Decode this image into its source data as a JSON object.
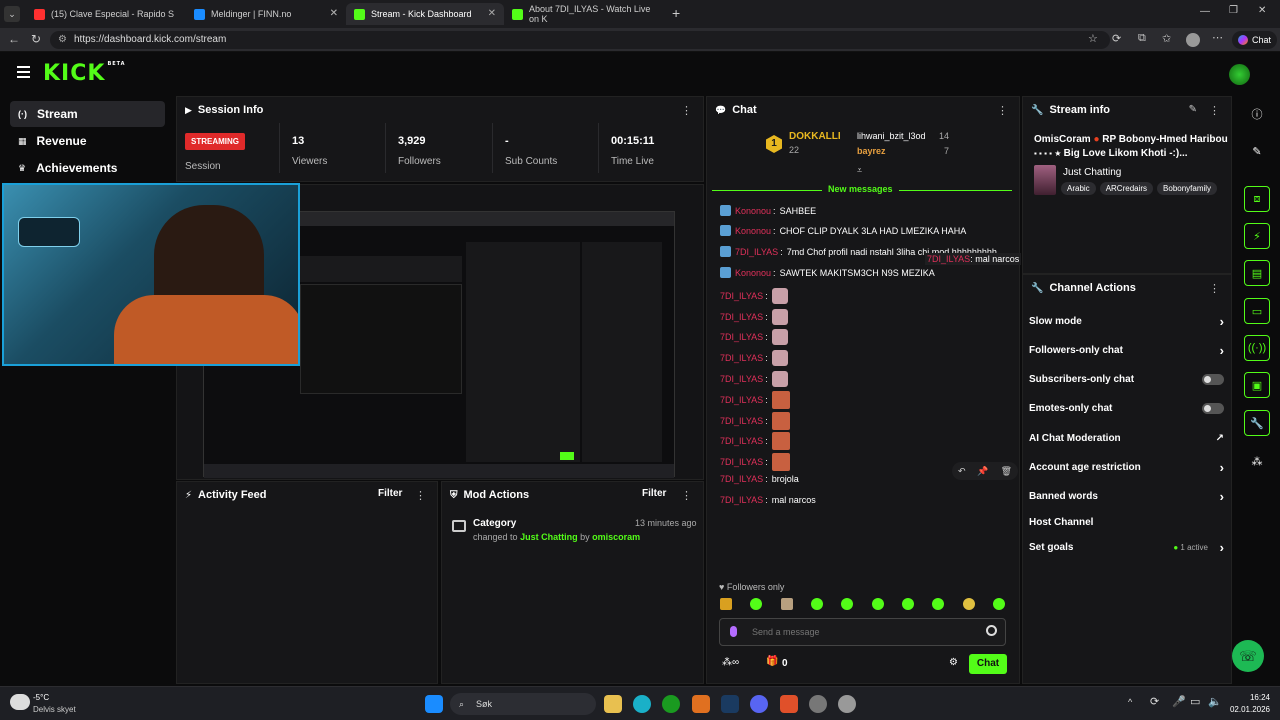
{
  "browser": {
    "tabs": [
      {
        "title": "(15) Clave Especial - Rapido S",
        "color": "#ff3030"
      },
      {
        "title": "Meldinger | FINN.no",
        "color": "#1a8cff"
      },
      {
        "title": "Stream - Kick Dashboard",
        "color": "#53fc18"
      },
      {
        "title": "About 7DI_ILYAS - Watch Live on K",
        "color": "#53fc18"
      }
    ],
    "url": "https://dashboard.kick.com/stream",
    "copilot_label": "Chat"
  },
  "brand": {
    "logo": "KICK",
    "beta": "BETA",
    "accent": "#53fc18"
  },
  "sidebar": {
    "items": [
      {
        "label": "Stream",
        "icon": "broadcast-icon"
      },
      {
        "label": "Revenue",
        "icon": "money-icon"
      },
      {
        "label": "Achievements",
        "icon": "trophy-icon"
      }
    ]
  },
  "session": {
    "title": "Session Info",
    "badge": "STREAMING",
    "badge_label": "Session",
    "stats": [
      {
        "value": "13",
        "label": "Viewers"
      },
      {
        "value": "3,929",
        "label": "Followers"
      },
      {
        "value": "-",
        "label": "Sub Counts"
      },
      {
        "value": "00:15:11",
        "label": "Time Live"
      }
    ]
  },
  "activity": {
    "title": "Activity Feed",
    "filter": "Filter"
  },
  "mod": {
    "title": "Mod Actions",
    "filter": "Filter",
    "entry": {
      "title": "Category",
      "time": "13 minutes ago",
      "pre": "changed to",
      "category": "Just Chatting",
      "by": "by",
      "user": "omiscoram"
    }
  },
  "chat": {
    "title": "Chat",
    "top": {
      "rank1": "1",
      "user1": "DOKKALLI",
      "count1": "22",
      "user2": "lihwani_bzit_l3od",
      "count2": "14",
      "user3": "bayrez",
      "count3": "7"
    },
    "new_messages": "New messages",
    "messages": [
      {
        "user": "Kononou",
        "text": "SAHBEE",
        "icon": true
      },
      {
        "user": "Kononou",
        "text": "CHOF CLIP DYALK 3LA HAD LMEZIKA HAHA",
        "icon": true
      },
      {
        "user": "7DI_ILYAS",
        "text": "7md Chof profil nadi nstahl 3liha chi mod hhhhhhhhh",
        "icon": true
      },
      {
        "user": "Kononou",
        "text": "SAWTEK MAKITSM3CH N9S MEZIKA",
        "icon": true
      },
      {
        "user": "7DI_ILYAS",
        "text": "",
        "emote": 1
      },
      {
        "user": "7DI_ILYAS",
        "text": "",
        "emote": 1
      },
      {
        "user": "7DI_ILYAS",
        "text": "",
        "emote": 1
      },
      {
        "user": "7DI_ILYAS",
        "text": "",
        "emote": 1
      },
      {
        "user": "7DI_ILYAS",
        "text": "",
        "emote": 1
      },
      {
        "user": "7DI_ILYAS",
        "text": "",
        "emote": 2
      },
      {
        "user": "7DI_ILYAS",
        "text": "",
        "emote": 2
      },
      {
        "user": "7DI_ILYAS",
        "text": "",
        "emote": 2
      },
      {
        "user": "7DI_ILYAS",
        "text": "",
        "emote": 2
      },
      {
        "user": "7DI_ILYAS",
        "text": "brojola"
      },
      {
        "user": "7DI_ILYAS",
        "text": "mal narcos"
      }
    ],
    "tooltip": {
      "user": "7DI_ILYAS",
      "text": ": mal narcos"
    },
    "followers_only": "Followers only",
    "placeholder": "Send a message",
    "points": "0",
    "send": "Chat"
  },
  "stream_info": {
    "title": "Stream info",
    "user": "OmisCoram",
    "line1": "RP Bobony-Hmed Haribou",
    "line2": "Big Love Likom Khoti -:)...",
    "category": "Just Chatting",
    "tags": [
      "Arabic",
      "ARCredairs",
      "Bobonyfamily"
    ]
  },
  "channel_actions": {
    "title": "Channel Actions",
    "items": [
      {
        "label": "Slow mode",
        "control": "chevron"
      },
      {
        "label": "Followers-only chat",
        "control": "chevron"
      },
      {
        "label": "Subscribers-only chat",
        "control": "toggle"
      },
      {
        "label": "Emotes-only chat",
        "control": "toggle"
      },
      {
        "label": "AI Chat Moderation",
        "control": "external"
      },
      {
        "label": "Account age restriction",
        "control": "chevron"
      },
      {
        "label": "Banned words",
        "control": "chevron"
      },
      {
        "label": "Host Channel",
        "control": "none"
      },
      {
        "label": "Set goals",
        "control": "chevron",
        "extra": "1 active"
      }
    ]
  },
  "taskbar": {
    "weather_temp": "-5°C",
    "weather_text": "Delvis skyet",
    "search": "Søk",
    "time": "16:24",
    "date": "02.01.2026"
  }
}
